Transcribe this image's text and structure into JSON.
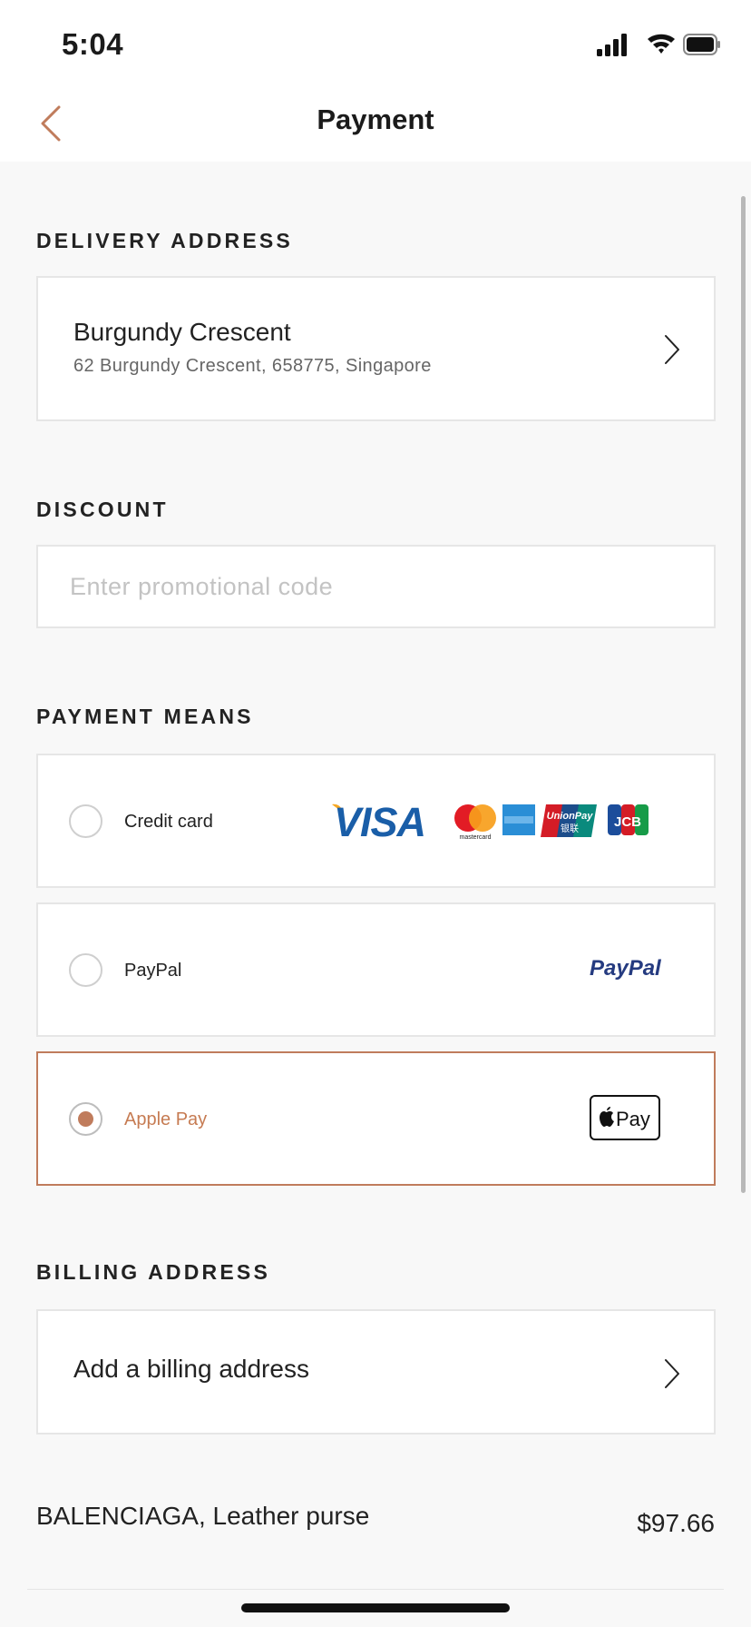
{
  "status": {
    "time": "5:04"
  },
  "nav": {
    "title": "Payment"
  },
  "delivery": {
    "section_title": "DELIVERY ADDRESS",
    "name": "Burgundy Crescent",
    "address": "62 Burgundy Crescent, 658775, Singapore"
  },
  "discount": {
    "section_title": "DISCOUNT",
    "placeholder": "Enter promotional code",
    "value": ""
  },
  "payment": {
    "section_title": "PAYMENT MEANS",
    "options": [
      {
        "label": "Credit card",
        "selected": false,
        "logos": [
          "visa-logo",
          "mastercard-logo",
          "amex-logo",
          "unionpay-logo",
          "jcb-logo"
        ]
      },
      {
        "label": "PayPal",
        "selected": false,
        "logos": [
          "paypal-logo"
        ]
      },
      {
        "label": "Apple Pay",
        "selected": true,
        "logos": [
          "apple-pay-logo"
        ]
      }
    ],
    "logo_text": {
      "visa": "VISA",
      "mastercard": "mastercard",
      "unionpay": "UnionPay",
      "unionpay_cn": "银联",
      "jcb": "JCB",
      "paypal": "PayPal",
      "applepay": "Pay"
    }
  },
  "billing": {
    "section_title": "BILLING ADDRESS",
    "action": "Add a billing address"
  },
  "summary": {
    "item": "BALENCIAGA, Leather purse",
    "price": "$97.66"
  },
  "colors": {
    "accent": "#c07c5c",
    "accent_text": "#c67b52",
    "background": "#f8f8f8",
    "card_border": "#e6e6e6"
  }
}
